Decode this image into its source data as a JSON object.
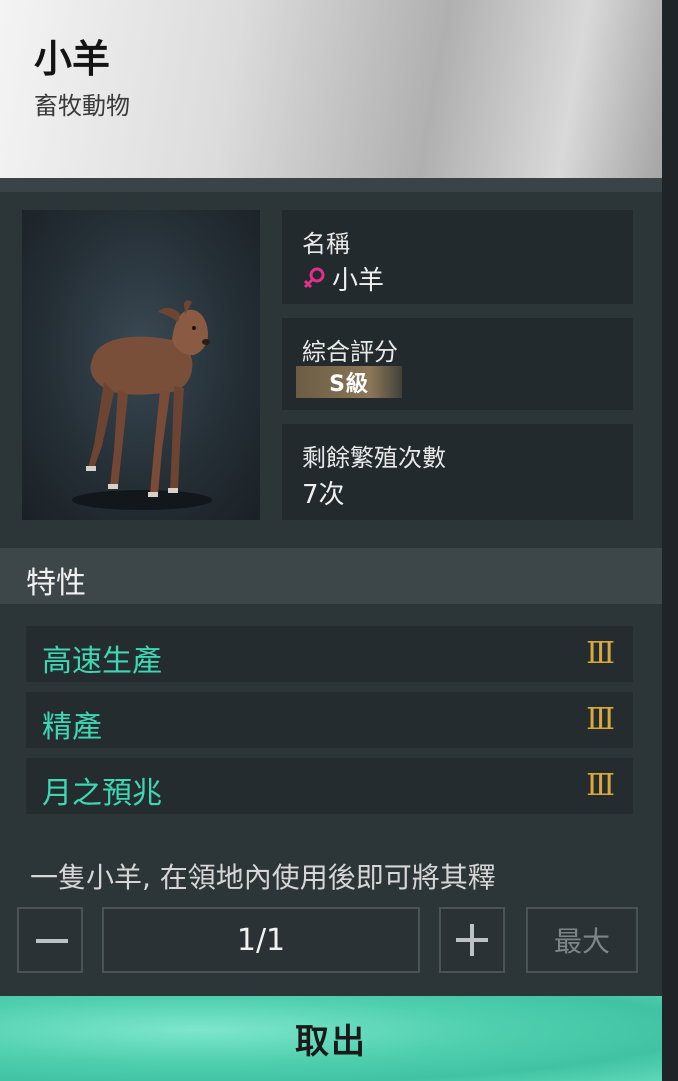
{
  "header": {
    "title": "小羊",
    "subtitle": "畜牧動物"
  },
  "info": {
    "name_label": "名稱",
    "name_value": "小羊",
    "gender_icon": "female-icon",
    "grade_label": "綜合評分",
    "grade_value": "S級",
    "breed_label": "剩餘繁殖次數",
    "breed_value": "7次"
  },
  "traits": {
    "title": "特性",
    "items": [
      {
        "name": "高速生產",
        "level": "Ⅲ"
      },
      {
        "name": "精產",
        "level": "Ⅲ"
      },
      {
        "name": "月之預兆",
        "level": "Ⅲ"
      }
    ]
  },
  "description": "一隻小羊, 在領地內使用後即可將其釋",
  "quantity": {
    "value": "1/1",
    "max_label": "最大"
  },
  "action": {
    "take_label": "取出"
  },
  "colors": {
    "accent": "#3fd6b4",
    "level": "#d9a93a",
    "button": "#4fcfae"
  }
}
